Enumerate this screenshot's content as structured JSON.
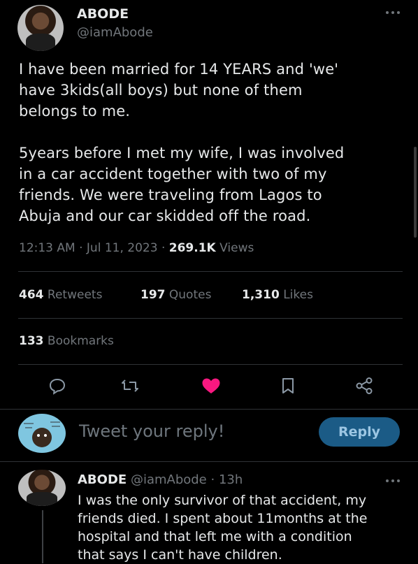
{
  "tweet": {
    "display_name": "ABODE",
    "handle": "@iamAbode",
    "paragraph1": [
      "I have been married for 14 YEARS and 'we'",
      "have 3kids(all boys) but none of them",
      "belongs to me."
    ],
    "paragraph2": [
      "5years before I met my wife, I was involved",
      "in a car accident together with two of my",
      "friends. We were traveling from Lagos to",
      "Abuja and our car skidded off the road."
    ],
    "time": "12:13 AM",
    "date": "Jul 11, 2023",
    "views_count": "269.1K",
    "views_label": "Views",
    "retweets_count": "464",
    "retweets_label": "Retweets",
    "quotes_count": "197",
    "quotes_label": "Quotes",
    "likes_count": "1,310",
    "likes_label": "Likes",
    "bookmarks_count": "133",
    "bookmarks_label": "Bookmarks",
    "more_icon": "more-dots-icon"
  },
  "actions": {
    "icons": [
      "reply-icon",
      "retweet-icon",
      "like-icon",
      "bookmark-icon",
      "share-icon"
    ],
    "like_color": "#f91880"
  },
  "composer": {
    "placeholder": "Tweet your reply!",
    "button_label": "Reply"
  },
  "reply": {
    "display_name": "ABODE",
    "handle": "@iamAbode",
    "separator": "·",
    "time_ago": "13h",
    "lines": [
      "I was the only survivor of that accident, my",
      "friends died. I spent about 11months at the",
      "hospital and that left me with a condition",
      "that says I can't have children."
    ]
  }
}
